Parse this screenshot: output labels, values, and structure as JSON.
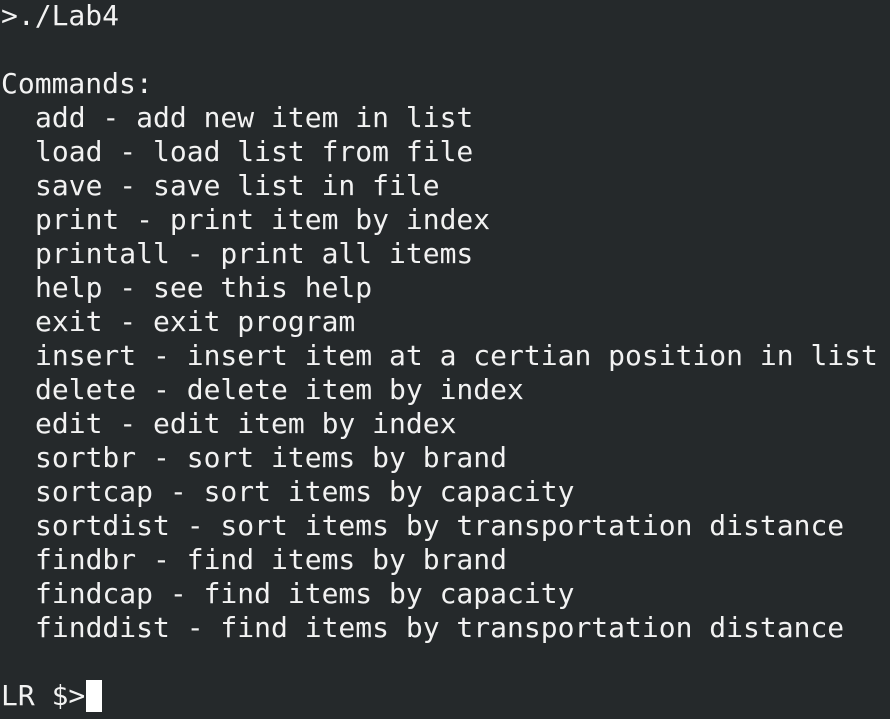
{
  "terminal": {
    "command_line": ">./Lab4",
    "commands_header": "Commands:",
    "commands": [
      "add - add new item in list",
      "load - load list from file",
      "save - save list in file",
      "print - print item by index",
      "printall - print all items",
      "help - see this help",
      "exit - exit program",
      "insert - insert item at a certian position in list",
      "delete - delete item by index",
      "edit - edit item by index",
      "sortbr - sort items by brand",
      "sortcap - sort items by capacity",
      "sortdist - sort items by transportation distance",
      "findbr - find items by brand",
      "findcap - find items by capacity",
      "finddist - find items by transportation distance"
    ],
    "prompt": "LR $>"
  },
  "colors": {
    "background": "#25292b",
    "text": "#f2f2f2",
    "cursor": "#ffffff"
  }
}
